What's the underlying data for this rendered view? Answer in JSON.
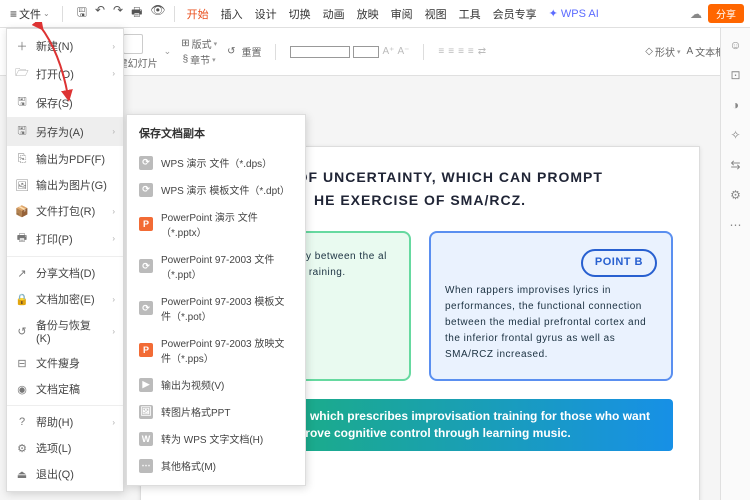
{
  "titlebar": {
    "file_label": "文件",
    "tabs": [
      "开始",
      "插入",
      "设计",
      "切换",
      "动画",
      "放映",
      "审阅",
      "视图",
      "工具",
      "会员专享"
    ],
    "ai": "WPS AI",
    "share": "分享"
  },
  "ribbon": {
    "new_slide": "新建幻灯片",
    "layout": "版式",
    "section": "章节",
    "reset": "重置",
    "shape": "形状",
    "textbox": "文本框"
  },
  "filemenu": {
    "items": [
      {
        "icon": "＋",
        "label": "新建(N)",
        "arrow": true
      },
      {
        "icon": "🗁",
        "label": "打开(O)",
        "arrow": true
      },
      {
        "icon": "🖫",
        "label": "保存(S)"
      },
      {
        "icon": "🖫",
        "label": "另存为(A)",
        "arrow": true,
        "hover": true
      },
      {
        "icon": "⎘",
        "label": "输出为PDF(F)"
      },
      {
        "icon": "🖼",
        "label": "输出为图片(G)"
      },
      {
        "icon": "📦",
        "label": "文件打包(R)",
        "arrow": true
      },
      {
        "icon": "🖶",
        "label": "打印(P)",
        "arrow": true
      },
      {
        "sep": true
      },
      {
        "icon": "↗",
        "label": "分享文档(D)"
      },
      {
        "icon": "🔒",
        "label": "文档加密(E)",
        "arrow": true
      },
      {
        "icon": "↺",
        "label": "备份与恢复(K)",
        "arrow": true
      },
      {
        "icon": "⊟",
        "label": "文件瘦身"
      },
      {
        "icon": "◉",
        "label": "文档定稿"
      },
      {
        "sep": true
      },
      {
        "icon": "?",
        "label": "帮助(H)",
        "arrow": true
      },
      {
        "icon": "⚙",
        "label": "选项(L)"
      },
      {
        "icon": "⏏",
        "label": "退出(Q)"
      }
    ]
  },
  "submenu": {
    "header": "保存文档副本",
    "items": [
      {
        "cls": "sgy",
        "i": "⟳",
        "label": "WPS 演示 文件（*.dps）"
      },
      {
        "cls": "sgy",
        "i": "⟳",
        "label": "WPS 演示 模板文件（*.dpt）"
      },
      {
        "cls": "sor",
        "i": "P",
        "label": "PowerPoint 演示 文件（*.pptx）"
      },
      {
        "cls": "sgy",
        "i": "⟳",
        "label": "PowerPoint 97-2003 文件（*.ppt）"
      },
      {
        "cls": "sgy",
        "i": "⟳",
        "label": "PowerPoint 97-2003 模板文件（*.pot）"
      },
      {
        "cls": "sor",
        "i": "P",
        "label": "PowerPoint 97-2003 放映文件（*.pps）"
      },
      {
        "cls": "sgy",
        "i": "▶",
        "label": "输出为视频(V)"
      },
      {
        "cls": "sgy",
        "i": "🖼",
        "label": "转图片格式PPT"
      },
      {
        "cls": "sgy",
        "i": "W",
        "label": "转为 WPS 文字文档(H)"
      },
      {
        "cls": "sgy",
        "i": "⋯",
        "label": "其他格式(M)"
      }
    ]
  },
  "slide": {
    "title_l1": "S FULL OF UNCERTAINTY, WHICH CAN PROMPT",
    "title_l2": "HE EXERCISE OF SMA/RCZ.",
    "pointB": "POINT B",
    "cardA": "f professional ut that the y between the al cortex and ed to the time raining.",
    "cardB": "When rappers improvises lyrics in performances, the functional connection between the medial prefrontal cortex and the inferior frontal gyrus as well as SMA/RCZ increased.",
    "footer": "with a recent finding which prescribes improvisation training for those who want to improve cognitive control through learning music."
  }
}
